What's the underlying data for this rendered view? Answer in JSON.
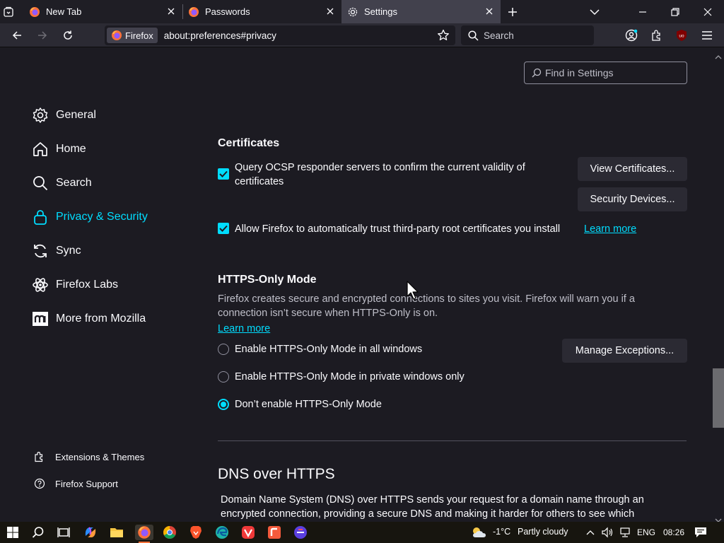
{
  "tabs": [
    {
      "label": "New Tab"
    },
    {
      "label": "Passwords"
    },
    {
      "label": "Settings"
    }
  ],
  "navbar": {
    "identity_label": "Firefox",
    "url": "about:preferences#privacy",
    "search_placeholder": "Search"
  },
  "settings": {
    "find_placeholder": "Find in Settings",
    "categories": [
      {
        "label": "General"
      },
      {
        "label": "Home"
      },
      {
        "label": "Search"
      },
      {
        "label": "Privacy & Security"
      },
      {
        "label": "Sync"
      },
      {
        "label": "Firefox Labs"
      },
      {
        "label": "More from Mozilla"
      }
    ],
    "footer": [
      {
        "label": "Extensions & Themes"
      },
      {
        "label": "Firefox Support"
      }
    ]
  },
  "certificates": {
    "heading": "Certificates",
    "ocsp_line1": "Query OCSP responder servers to confirm the current validity of",
    "ocsp_line2": "certificates",
    "ocsp_checked": true,
    "view_button": "View Certificates...",
    "devices_button": "Security Devices...",
    "trust_label": "Allow Firefox to automatically trust third-party root certificates you install",
    "trust_checked": true,
    "learn_more": "Learn more"
  },
  "https_only": {
    "heading": "HTTPS-Only Mode",
    "desc_line1": "Firefox creates secure and encrypted connections to sites you visit. Firefox will warn you if a",
    "desc_line2": "connection isn’t secure when HTTPS-Only is on.",
    "learn_more": "Learn more",
    "manage_button": "Manage Exceptions...",
    "options": [
      {
        "label": "Enable HTTPS-Only Mode in all windows",
        "selected": false
      },
      {
        "label": "Enable HTTPS-Only Mode in private windows only",
        "selected": false
      },
      {
        "label": "Don’t enable HTTPS-Only Mode",
        "selected": true
      }
    ]
  },
  "dns": {
    "heading": "DNS over HTTPS",
    "desc_line1": "Domain Name System (DNS) over HTTPS sends your request for a domain name through an",
    "desc_line2": "encrypted connection, providing a secure DNS and making it harder for others to see which"
  },
  "taskbar": {
    "temperature": "-1°C",
    "weather": "Partly cloudy",
    "language": "ENG",
    "time": "08:26"
  },
  "colors": {
    "accent": "#00ddff",
    "background": "#1c1b22",
    "toolbar": "#2b2a33"
  }
}
